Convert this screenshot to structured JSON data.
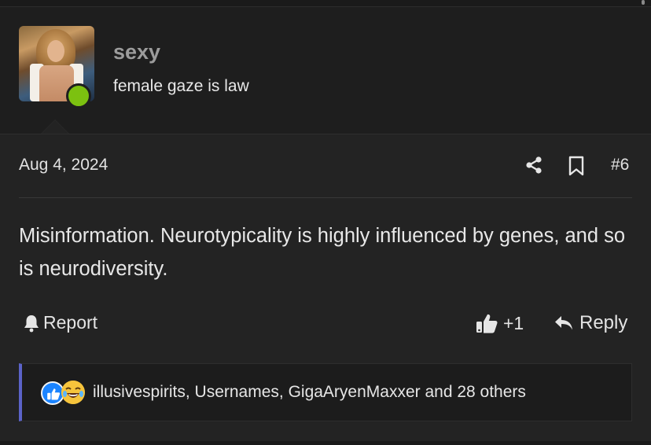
{
  "user": {
    "name": "sexy",
    "title": "female gaze is law",
    "online_color": "#7cc110"
  },
  "post": {
    "date": "Aug 4, 2024",
    "number": "#6",
    "message": "Misinformation. Neurotypicality is highly influenced by genes, and so is neurodiversity.",
    "icons": {
      "share": "share-icon",
      "bookmark": "bookmark-icon"
    }
  },
  "actions": {
    "report_label": "Report",
    "like_count": "+1",
    "reply_label": "Reply"
  },
  "reactions": {
    "icons": [
      "like-reaction-icon",
      "laugh-reaction-icon"
    ],
    "summary": "illusivespirits, Usernames, GigaAryenMaxxer and 28 others",
    "accent": "#5b63c8"
  }
}
